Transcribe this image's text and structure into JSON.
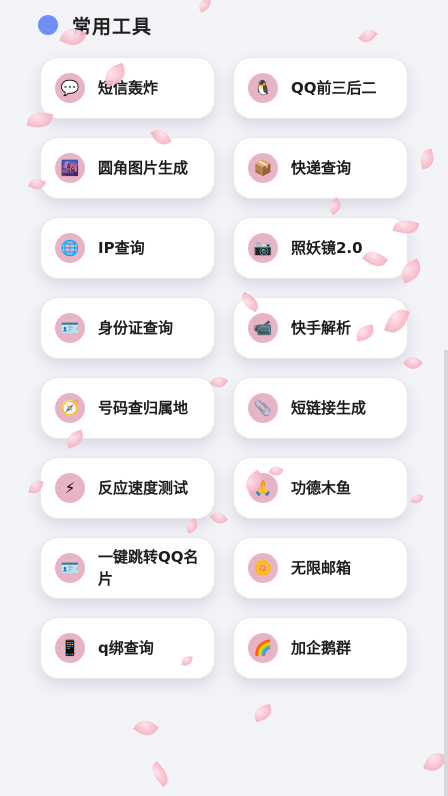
{
  "section": {
    "title": "常用工具",
    "dot_color": "#6f8ff6"
  },
  "tools": [
    {
      "label": "短信轰炸",
      "icon": "speech-bubble-icon",
      "glyph": "💬"
    },
    {
      "label": "QQ前三后二",
      "icon": "penguin-icon",
      "glyph": "🐧"
    },
    {
      "label": "圆角图片生成",
      "icon": "city-picture-icon",
      "glyph": "🌆"
    },
    {
      "label": "快递查询",
      "icon": "package-icon",
      "glyph": "📦"
    },
    {
      "label": "IP查询",
      "icon": "globe-icon",
      "glyph": "🌐"
    },
    {
      "label": "照妖镜2.0",
      "icon": "camera-icon",
      "glyph": "📷"
    },
    {
      "label": "身份证查询",
      "icon": "id-card-icon",
      "glyph": "🪪"
    },
    {
      "label": "快手解析",
      "icon": "video-camera-icon",
      "glyph": "📹"
    },
    {
      "label": "号码查归属地",
      "icon": "compass-icon",
      "glyph": "🧭"
    },
    {
      "label": "短链接生成",
      "icon": "paperclip-icon",
      "glyph": "📎"
    },
    {
      "label": "反应速度测试",
      "icon": "lightning-icon",
      "glyph": "⚡"
    },
    {
      "label": "功德木鱼",
      "icon": "praying-hands-icon",
      "glyph": "🙏"
    },
    {
      "label": "一键跳转QQ名片",
      "icon": "contact-card-icon",
      "glyph": "🪪"
    },
    {
      "label": "无限邮箱",
      "icon": "sun-flower-icon",
      "glyph": "🌼"
    },
    {
      "label": "q绑查询",
      "icon": "mobile-phone-icon",
      "glyph": "📱"
    },
    {
      "label": "加企鹅群",
      "icon": "rainbow-icon",
      "glyph": "🌈"
    }
  ],
  "colors": {
    "icon_bg": "#e7b3c6",
    "petal": "#f7b8c8",
    "background": "#f3f4f8"
  }
}
